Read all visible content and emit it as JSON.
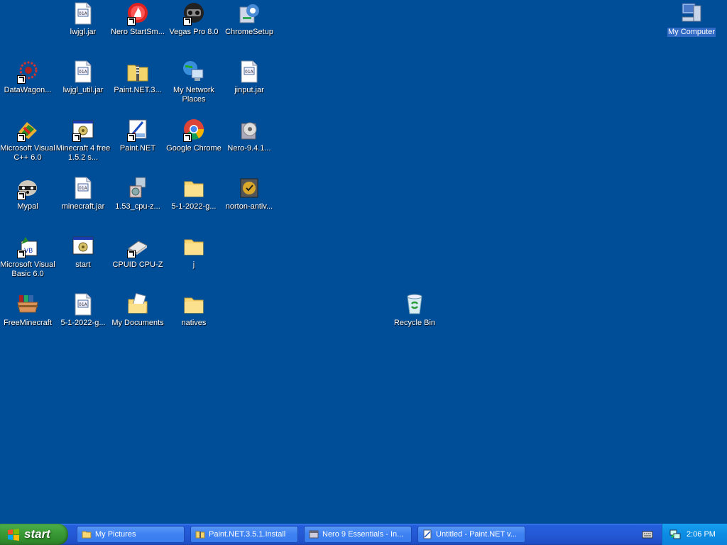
{
  "desktop": {
    "icons": [
      {
        "label": "lwjgl.jar"
      },
      {
        "label": "Nero StartSm..."
      },
      {
        "label": "Vegas Pro 8.0"
      },
      {
        "label": "ChromeSetup"
      },
      {
        "label": "DataWagon..."
      },
      {
        "label": "lwjgl_util.jar"
      },
      {
        "label": "Paint.NET.3..."
      },
      {
        "label": "My Network Places"
      },
      {
        "label": "jinput.jar"
      },
      {
        "label": "Microsoft Visual C++ 6.0"
      },
      {
        "label": "Minecraft 4 free 1.5.2 s..."
      },
      {
        "label": "Paint.NET"
      },
      {
        "label": "Google Chrome"
      },
      {
        "label": "Nero-9.4.1..."
      },
      {
        "label": "Mypal"
      },
      {
        "label": "minecraft.jar"
      },
      {
        "label": "1.53_cpu-z..."
      },
      {
        "label": "5-1-2022-g..."
      },
      {
        "label": "norton-antiv..."
      },
      {
        "label": "Microsoft Visual Basic 6.0"
      },
      {
        "label": "start"
      },
      {
        "label": "CPUID CPU-Z"
      },
      {
        "label": "j"
      },
      {
        "label": "FreeMinecraft"
      },
      {
        "label": "5-1-2022-g..."
      },
      {
        "label": "My Documents"
      },
      {
        "label": "natives"
      },
      {
        "label": "Recycle Bin"
      },
      {
        "label": "My Computer"
      }
    ]
  },
  "taskbar": {
    "start_label": "start",
    "tasks": [
      {
        "label": "My Pictures"
      },
      {
        "label": "Paint.NET.3.5.1.Install"
      },
      {
        "label": "Nero 9 Essentials - In..."
      },
      {
        "label": "Untitled - Paint.NET v..."
      }
    ],
    "clock": "2:06 PM"
  },
  "colors": {
    "desktop_background": "#004E98",
    "taskbar": "#245EDC",
    "start_button": "#3C9D38",
    "tray": "#0C8CE4",
    "selection": "#316AC5"
  }
}
